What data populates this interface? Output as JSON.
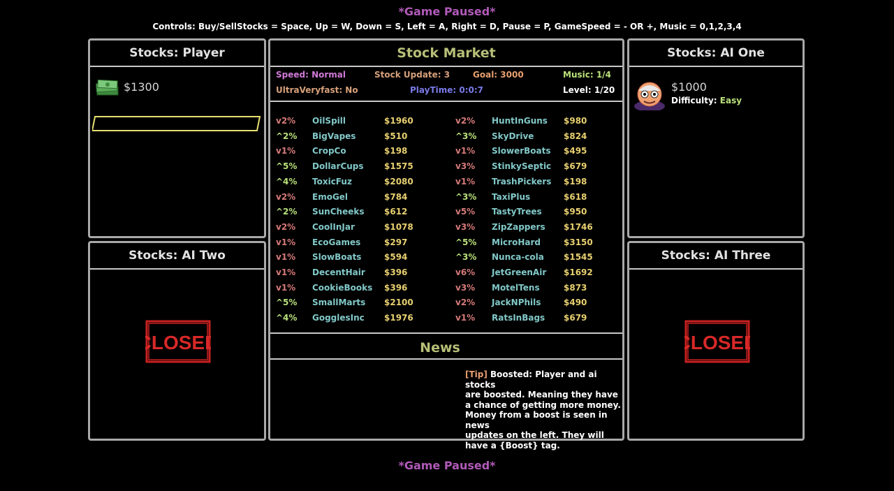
{
  "header": {
    "paused_top": "*Game Paused*",
    "controls": "Controls: Buy/SellStocks = Space, Up = W, Down = S, Left = A, Right = D, Pause = P, GameSpeed = - OR +, Music = 0,1,2,3,4",
    "paused_bottom": "*Game Paused*"
  },
  "player": {
    "title": "Stocks: Player",
    "money": "$1300",
    "icon": "cash-stack-icon"
  },
  "ai_one": {
    "title": "Stocks: AI One",
    "money": "$1000",
    "difficulty_label": "Difficulty:",
    "difficulty": "Easy",
    "icon": "ai-avatar-icon"
  },
  "ai_two": {
    "title": "Stocks: AI Two",
    "status": "CLOSED"
  },
  "ai_three": {
    "title": "Stocks: AI Three",
    "status": "CLOSED"
  },
  "market": {
    "title": "Stock Market",
    "speed": "Speed: Normal",
    "stock_update": "Stock Update: 3",
    "goal": "Goal: 3000",
    "music": "Music: 1/4",
    "ultra": "UltraVeryfast: No",
    "playtime": "PlayTime: 0:0:7",
    "level": "Level: 1/20",
    "colors": {
      "speed": "#d07ad8",
      "stock_update": "#d6a07a",
      "goal": "#e8a070",
      "music": "#b9e07a",
      "playtime": "#7a7ae8"
    },
    "left_stocks": [
      {
        "chg": "v2%",
        "name": "OilSpill",
        "price": "$1960",
        "dir": "down"
      },
      {
        "chg": "^2%",
        "name": "BigVapes",
        "price": "$510",
        "dir": "up"
      },
      {
        "chg": "v1%",
        "name": "CropCo",
        "price": "$198",
        "dir": "down"
      },
      {
        "chg": "^5%",
        "name": "DollarCups",
        "price": "$1575",
        "dir": "up"
      },
      {
        "chg": "^4%",
        "name": "ToxicFuz",
        "price": "$2080",
        "dir": "up"
      },
      {
        "chg": "v2%",
        "name": "EmoGel",
        "price": "$784",
        "dir": "down"
      },
      {
        "chg": "^2%",
        "name": "SunCheeks",
        "price": "$612",
        "dir": "up"
      },
      {
        "chg": "v2%",
        "name": "CoolInJar",
        "price": "$1078",
        "dir": "down"
      },
      {
        "chg": "v1%",
        "name": "EcoGames",
        "price": "$297",
        "dir": "down"
      },
      {
        "chg": "v1%",
        "name": "SlowBoats",
        "price": "$594",
        "dir": "down"
      },
      {
        "chg": "v1%",
        "name": "DecentHair",
        "price": "$396",
        "dir": "down"
      },
      {
        "chg": "v1%",
        "name": "CookieBooks",
        "price": "$396",
        "dir": "down"
      },
      {
        "chg": "^5%",
        "name": "SmallMarts",
        "price": "$2100",
        "dir": "up"
      },
      {
        "chg": "^4%",
        "name": "GogglesInc",
        "price": "$1976",
        "dir": "up"
      }
    ],
    "right_stocks": [
      {
        "chg": "v2%",
        "name": "HuntInGuns",
        "price": "$980",
        "dir": "down"
      },
      {
        "chg": "^3%",
        "name": "SkyDrive",
        "price": "$824",
        "dir": "up"
      },
      {
        "chg": "v1%",
        "name": "SlowerBoats",
        "price": "$495",
        "dir": "down"
      },
      {
        "chg": "v3%",
        "name": "StinkySeptic",
        "price": "$679",
        "dir": "down"
      },
      {
        "chg": "v1%",
        "name": "TrashPickers",
        "price": "$198",
        "dir": "down"
      },
      {
        "chg": "^3%",
        "name": "TaxiPlus",
        "price": "$618",
        "dir": "up"
      },
      {
        "chg": "v5%",
        "name": "TastyTrees",
        "price": "$950",
        "dir": "down"
      },
      {
        "chg": "v3%",
        "name": "ZipZappers",
        "price": "$1746",
        "dir": "down"
      },
      {
        "chg": "^5%",
        "name": "MicroHard",
        "price": "$3150",
        "dir": "up"
      },
      {
        "chg": "^3%",
        "name": "Nunca-cola",
        "price": "$1545",
        "dir": "up"
      },
      {
        "chg": "v6%",
        "name": "JetGreenAir",
        "price": "$1692",
        "dir": "down"
      },
      {
        "chg": "v3%",
        "name": "MotelTens",
        "price": "$873",
        "dir": "down"
      },
      {
        "chg": "v2%",
        "name": "JackNPhils",
        "price": "$490",
        "dir": "down"
      },
      {
        "chg": "v1%",
        "name": "RatsInBags",
        "price": "$679",
        "dir": "down"
      }
    ]
  },
  "news": {
    "title": "News",
    "tip_tag": "[Tip]",
    "tip_text": " Boosted: Player and ai stocks\nare boosted. Meaning they have\na chance of getting more money.\nMoney from a boost is seen in news\nupdates on the left. They will\nhave a {Boost} tag."
  }
}
